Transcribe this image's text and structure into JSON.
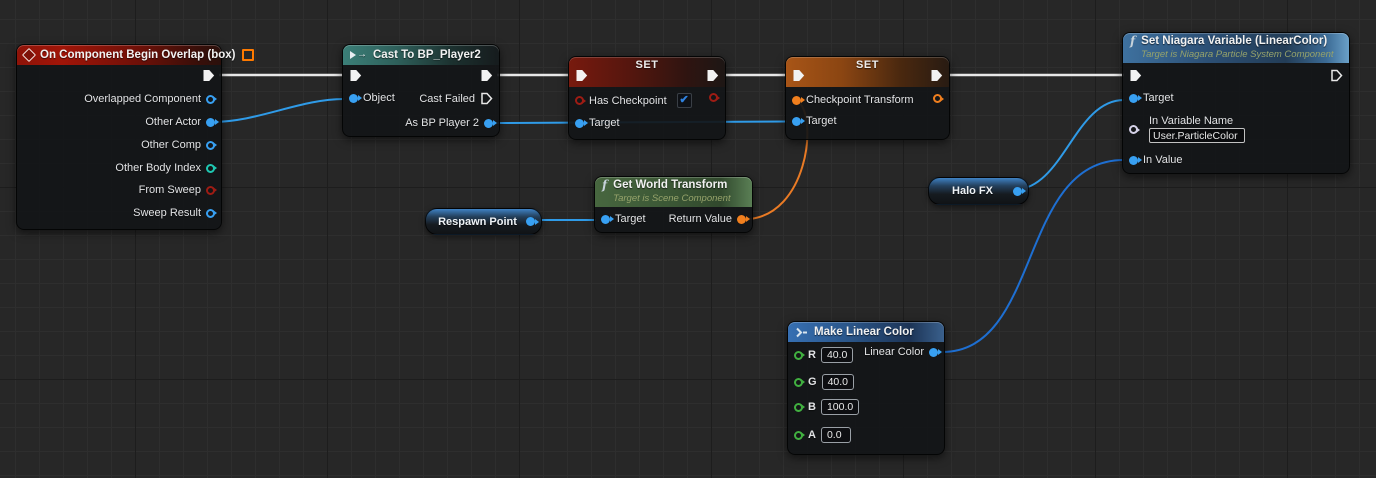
{
  "colors": {
    "grid_bg": "#272727",
    "exec_wire": "#e8e8e8",
    "object_wire": "#2f9be8",
    "linearcolor_wire": "#1e6fd2",
    "transform_wire": "#ea7b25",
    "object_pin": "#38a0f2",
    "bool_pin": "#9e1c14",
    "int_pin": "#1fc8b2",
    "transform_pin": "#f07f1e",
    "float_pin": "#41b040",
    "name_pin": "#d6d2e8",
    "event_header": "#a11508",
    "cast_header": "#3b7f78",
    "bool_header": "#7d1a0d",
    "transform_header": "#a85517",
    "function_header": "#3e719f",
    "pure_green_header": "#47663f",
    "checkbox_check": "#2f82e0"
  },
  "icons": {
    "function_icon": "f",
    "cast_arrow": "→",
    "checkmark": "✔"
  },
  "nodes": {
    "begin_overlap": {
      "title": "On Component Begin Overlap (box)",
      "pins": {
        "overlapped_component": "Overlapped Component",
        "other_actor": "Other Actor",
        "other_comp": "Other Comp",
        "other_body_index": "Other Body Index",
        "from_sweep": "From Sweep",
        "sweep_result": "Sweep Result"
      }
    },
    "cast": {
      "title": "Cast To BP_Player2",
      "pins": {
        "object": "Object",
        "cast_failed": "Cast Failed",
        "as_bp_player2": "As BP Player 2"
      }
    },
    "set_has_checkpoint": {
      "title": "SET",
      "pins": {
        "has_checkpoint": "Has Checkpoint",
        "target": "Target"
      },
      "checkbox_checked": true
    },
    "set_checkpoint_transform": {
      "title": "SET",
      "pins": {
        "checkpoint_transform": "Checkpoint Transform",
        "target": "Target"
      }
    },
    "set_niagara_variable": {
      "title": "Set Niagara Variable (LinearColor)",
      "subtitle": "Target is Niagara Particle System Component",
      "pins": {
        "target": "Target",
        "in_variable_name": "In Variable Name",
        "in_value": "In Value"
      },
      "in_variable_name_value": "User.ParticleColor"
    },
    "get_world_transform": {
      "title": "Get World Transform",
      "subtitle": "Target is Scene Component",
      "pins": {
        "target": "Target",
        "return_value": "Return Value"
      }
    },
    "respawn_point": {
      "label": "Respawn Point"
    },
    "halo_fx": {
      "label": "Halo FX"
    },
    "make_linear_color": {
      "title": "Make Linear Color",
      "pins": {
        "r": "R",
        "g": "G",
        "b": "B",
        "a": "A",
        "linear_color": "Linear Color"
      },
      "values": {
        "r": "40.0",
        "g": "40.0",
        "b": "100.0",
        "a": "0.0"
      }
    }
  }
}
